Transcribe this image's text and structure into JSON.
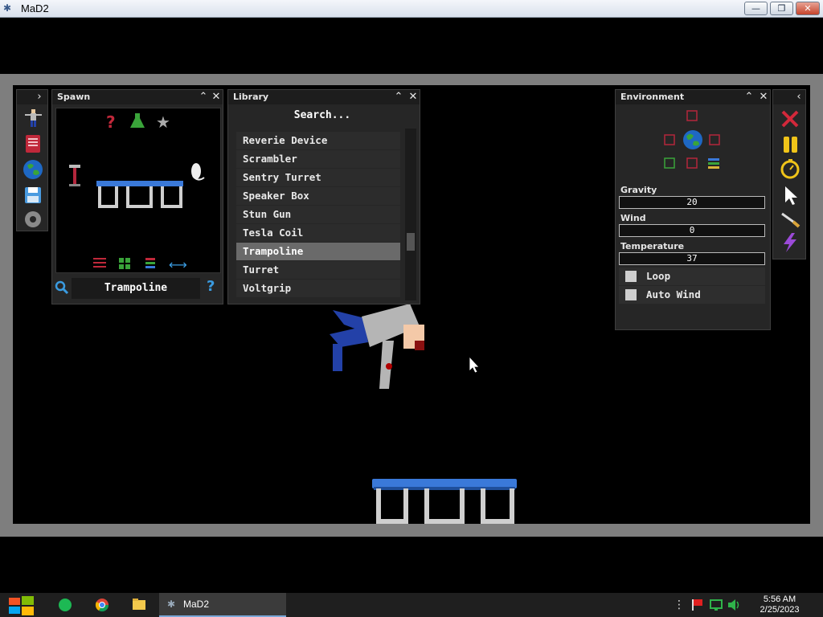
{
  "window": {
    "title": "MaD2",
    "minimize": "—",
    "maximize": "❐",
    "close": "✕"
  },
  "spawn": {
    "title": "Spawn",
    "selected_name": "Trampoline",
    "collapse": "⌃",
    "close": "✕",
    "help": "?"
  },
  "library": {
    "title": "Library",
    "search_placeholder": "Search...",
    "collapse": "⌃",
    "close": "✕",
    "items": [
      {
        "label": "Reverie Device"
      },
      {
        "label": "Scrambler"
      },
      {
        "label": "Sentry Turret"
      },
      {
        "label": "Speaker Box"
      },
      {
        "label": "Stun Gun"
      },
      {
        "label": "Tesla Coil"
      },
      {
        "label": "Trampoline",
        "selected": true
      },
      {
        "label": "Turret"
      },
      {
        "label": "Voltgrip"
      }
    ],
    "scroll_position": 0.68
  },
  "environment": {
    "title": "Environment",
    "collapse": "⌃",
    "close": "✕",
    "gravity": {
      "label": "Gravity",
      "value": "20"
    },
    "wind": {
      "label": "Wind",
      "value": "0"
    },
    "temperature": {
      "label": "Temperature",
      "value": "37"
    },
    "loop": {
      "label": "Loop",
      "checked": false
    },
    "auto_wind": {
      "label": "Auto Wind",
      "checked": false
    }
  },
  "left_toolbar": {
    "expand": "›",
    "tools": [
      "ragdoll-icon",
      "book-icon",
      "globe-icon",
      "save-icon",
      "settings-icon"
    ]
  },
  "right_toolbar": {
    "collapse": "‹",
    "tools": [
      "delete-icon",
      "pause-icon",
      "timer-icon",
      "cursor-icon",
      "knife-icon",
      "lightning-icon"
    ]
  },
  "taskbar": {
    "app_label": "MaD2",
    "time": "5:56 AM",
    "date": "2/25/2023"
  },
  "colors": {
    "panel": "#262626",
    "trampoline_bed": "#3a79d9",
    "trampoline_legs": "#cfcfcf",
    "blood": "#b00000",
    "ragdoll_pants": "#2341a8",
    "ragdoll_shirt": "#b5b5b5"
  }
}
